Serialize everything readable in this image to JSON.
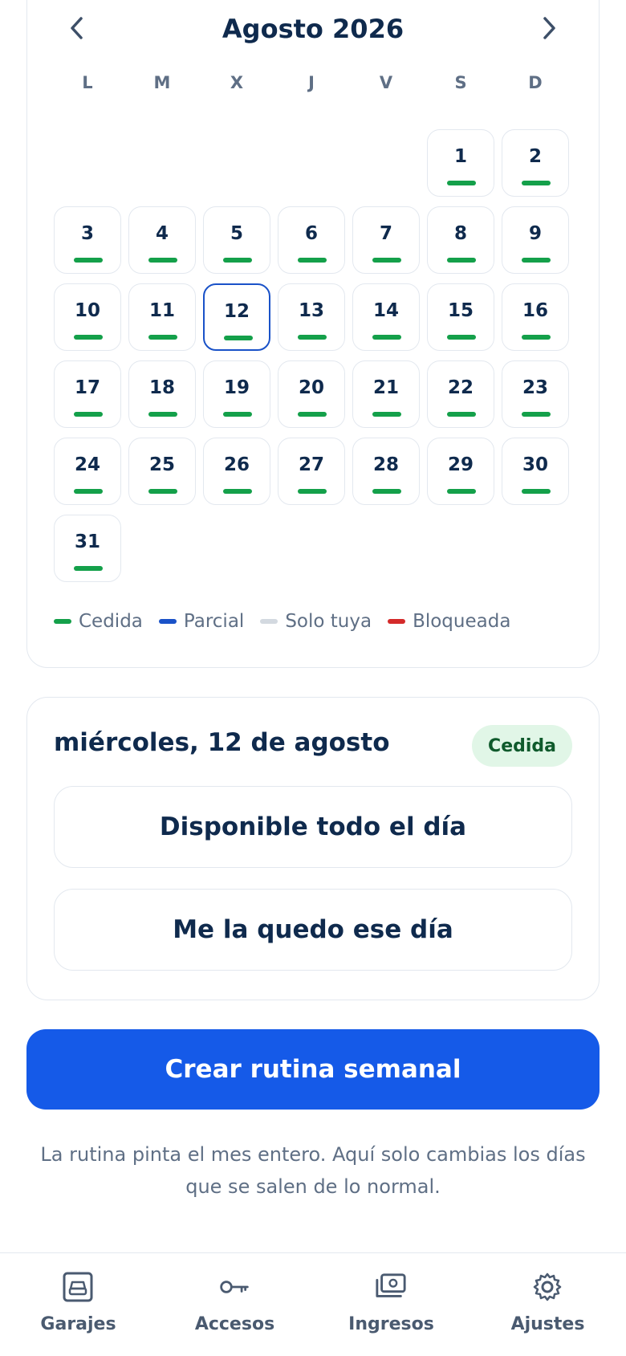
{
  "calendar": {
    "month_title": "Agosto 2026",
    "weekdays": [
      "L",
      "M",
      "X",
      "J",
      "V",
      "S",
      "D"
    ],
    "first_weekday_index": 5,
    "days_in_month": 31,
    "selected_day": 12,
    "day_status": "cedida",
    "status_colors": {
      "cedida": "#14a04a",
      "parcial": "#1a52c8",
      "solo_tuya": "#d3d9e0",
      "bloqueada": "#d42a2a"
    },
    "legend": [
      {
        "label": "Cedida",
        "color": "#14a04a"
      },
      {
        "label": "Parcial",
        "color": "#1a52c8"
      },
      {
        "label": "Solo tuya",
        "color": "#d3d9e0"
      },
      {
        "label": "Bloqueada",
        "color": "#d42a2a"
      }
    ]
  },
  "detail": {
    "date_label": "miércoles, 12 de agosto",
    "status_badge": "Cedida",
    "option_all_day": "Disponible todo el día",
    "option_keep": "Me la quedo ese día"
  },
  "actions": {
    "create_routine": "Crear rutina semanal",
    "hint": "La rutina pinta el mes entero. Aquí solo cambias los días que se salen de lo normal."
  },
  "tabbar": {
    "items": [
      {
        "label": "Garajes",
        "icon": "garage-icon"
      },
      {
        "label": "Accesos",
        "icon": "key-icon"
      },
      {
        "label": "Ingresos",
        "icon": "cash-icon"
      },
      {
        "label": "Ajustes",
        "icon": "gear-icon"
      }
    ]
  },
  "colors": {
    "accent": "#155ae8",
    "text": "#0f2a4d",
    "muted": "#5f6f85",
    "badge_bg": "#e1f6e7"
  }
}
